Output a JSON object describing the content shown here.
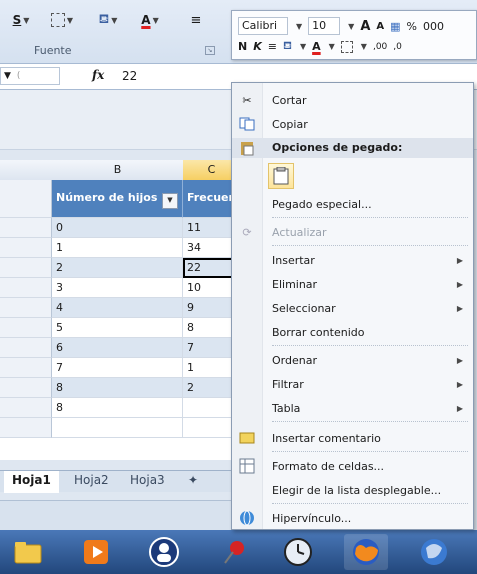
{
  "ribbon": {
    "group_label": "Fuente",
    "btn_s": "S",
    "btn_a": "A"
  },
  "formula_bar": {
    "fx_label": "fx",
    "value": "22"
  },
  "sheet": {
    "col_b": "B",
    "col_c": "C",
    "header_b": "Número de hijos",
    "header_c": "Frecuen",
    "rows": [
      {
        "b": "0",
        "c": "11"
      },
      {
        "b": "1",
        "c": "34"
      },
      {
        "b": "2",
        "c": "22"
      },
      {
        "b": "3",
        "c": "10"
      },
      {
        "b": "4",
        "c": "9"
      },
      {
        "b": "5",
        "c": "8"
      },
      {
        "b": "6",
        "c": "7"
      },
      {
        "b": "7",
        "c": "1"
      },
      {
        "b": "8",
        "c": "2"
      },
      {
        "b": "8",
        "c": ""
      }
    ],
    "tabs": [
      "Hoja1",
      "Hoja2",
      "Hoja3"
    ]
  },
  "mini_toolbar": {
    "font": "Calibri",
    "size": "10",
    "bold": "N",
    "italic": "K",
    "percent": "%",
    "thousands": "000",
    "grow": "A",
    "shrink": "A",
    "inc_dec": ",00",
    "dec_dec": ",0"
  },
  "context_menu": {
    "items": {
      "cut": "Cortar",
      "copy": "Copiar",
      "paste_options": "Opciones de pegado:",
      "paste_special": "Pegado especial...",
      "refresh": "Actualizar",
      "insert": "Insertar",
      "delete": "Eliminar",
      "select": "Seleccionar",
      "clear": "Borrar contenido",
      "sort": "Ordenar",
      "filter": "Filtrar",
      "table": "Tabla",
      "insert_comment": "Insertar comentario",
      "format_cells": "Formato de celdas...",
      "pick_list": "Elegir de la lista desplegable...",
      "hyperlink": "Hipervínculo..."
    }
  },
  "colors": {
    "header_blue": "#4f81bd",
    "band_row": "#dbe5f1",
    "taskbar": "#2d5a96"
  }
}
